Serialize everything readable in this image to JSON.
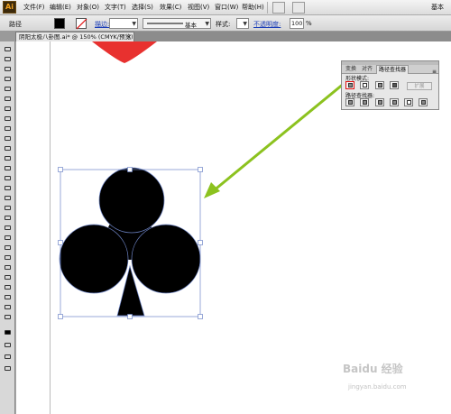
{
  "app": {
    "logo": "Ai"
  },
  "menubar": {
    "items": [
      "文件(F)",
      "编辑(E)",
      "对象(O)",
      "文字(T)",
      "选择(S)",
      "效果(C)",
      "视图(V)",
      "窗口(W)",
      "帮助(H)"
    ],
    "right_label": "基本"
  },
  "controlbar": {
    "selection_label": "路径",
    "stroke_label": "描边:",
    "stroke_profile": "基本",
    "style_label": "样式:",
    "opacity_label": "不透明度:",
    "opacity_value": "100",
    "opacity_unit": "%"
  },
  "document": {
    "tab_title": "阴阳太极八卦图.ai* @ 150% (CMYK/预览)",
    "close_glyph": "×"
  },
  "pathfinder_panel": {
    "tabs": [
      "变换",
      "对齐",
      "路径查找器"
    ],
    "active_tab": 2,
    "shape_modes_label": "形状模式:",
    "expand_label": "扩展",
    "pathfinders_label": "路径查找器:",
    "menu_glyph": "≡",
    "shape_modes": [
      "unite",
      "minus-front",
      "intersect",
      "exclude"
    ],
    "pathfinder_ops": [
      "divide",
      "trim",
      "merge",
      "crop",
      "outline",
      "minus-back"
    ]
  },
  "artwork": {
    "shape": "club",
    "fill": "#000000",
    "heart_fill": "#e8312f",
    "arrow_color": "#8cc21f",
    "selection_color": "#6f86c8"
  },
  "watermark": {
    "text": "Baidu 经验",
    "sub": "jingyan.baidu.com"
  }
}
